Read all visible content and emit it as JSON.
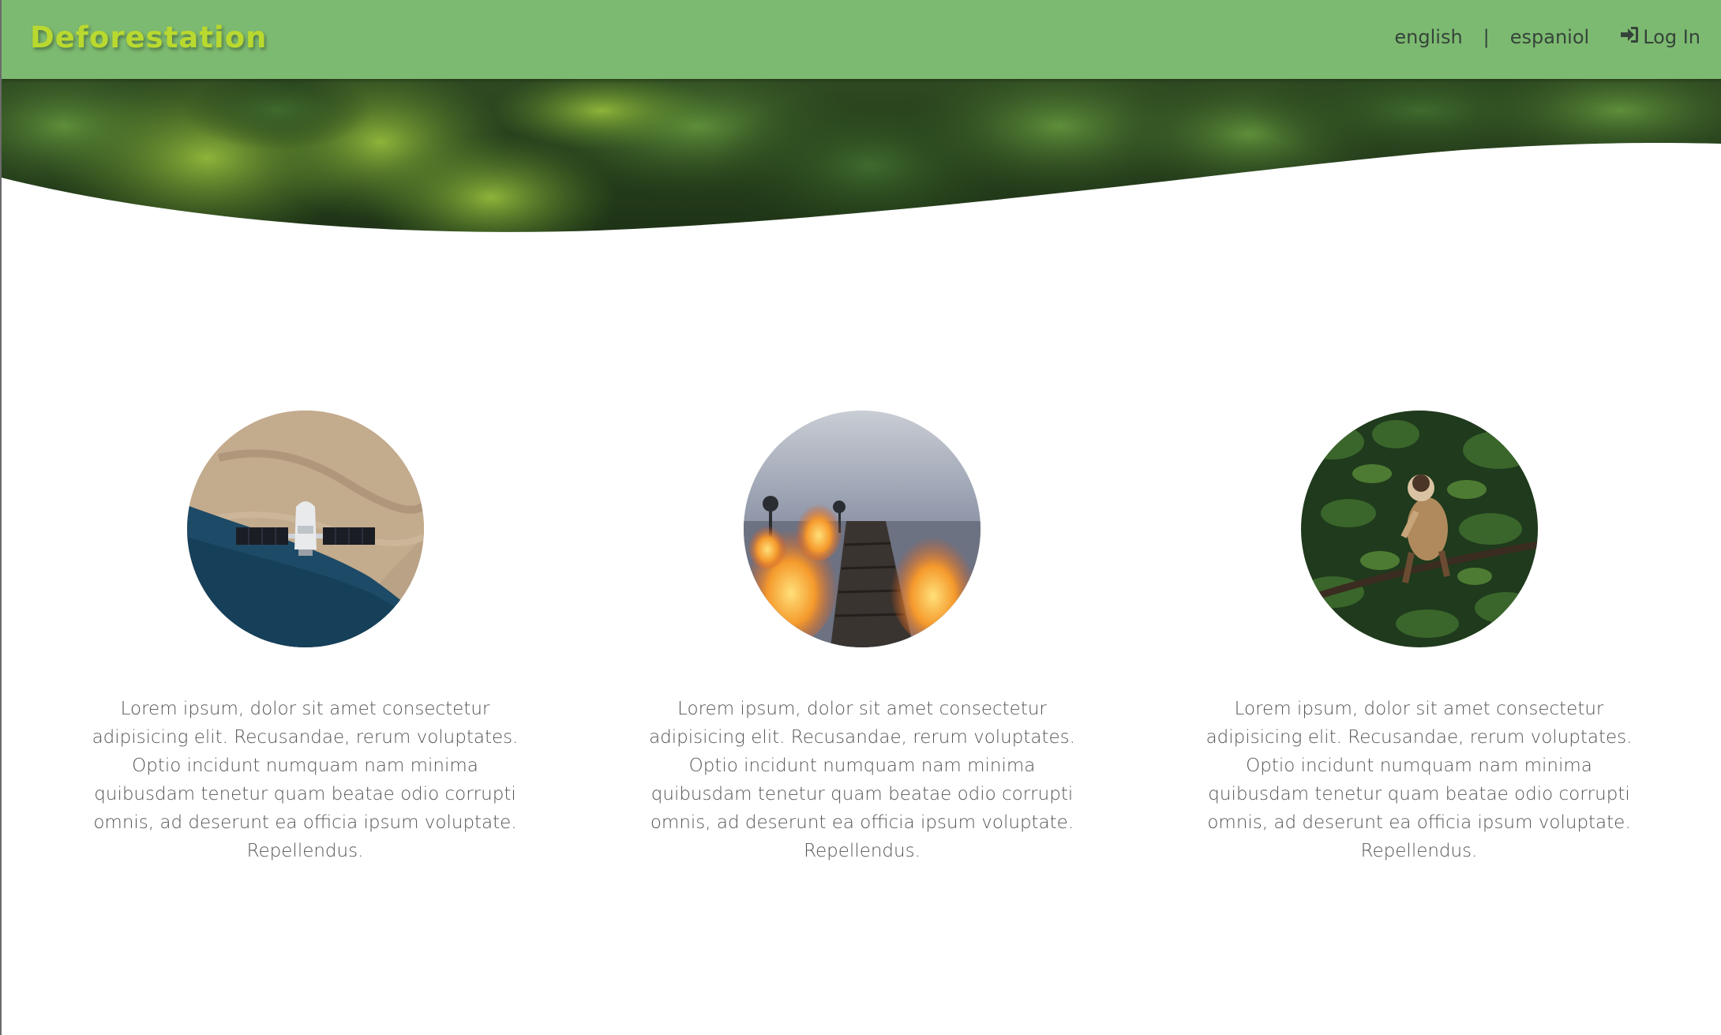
{
  "navbar": {
    "brand": "Deforestation",
    "lang_english": "english",
    "separator": "|",
    "lang_spanish": "espaniol",
    "login_label": "Log In",
    "login_icon": "sign-in-icon",
    "background_color": "#7dba71",
    "brand_color": "#b9d92f"
  },
  "hero": {
    "image": "rainforest-canopy-banner"
  },
  "features": [
    {
      "image": "satellite-over-coastline",
      "text": "Lorem ipsum, dolor sit amet consectetur adipisicing elit. Recusandae, rerum voluptates. Optio incidunt numquam nam minima quibusdam tenetur quam beatae odio corrupti omnis, ad deserunt ea officia ipsum voluptate. Repellendus."
    },
    {
      "image": "burning-log-fire",
      "text": "Lorem ipsum, dolor sit amet consectetur adipisicing elit. Recusandae, rerum voluptates. Optio incidunt numquam nam minima quibusdam tenetur quam beatae odio corrupti omnis, ad deserunt ea officia ipsum voluptate. Repellendus."
    },
    {
      "image": "monkey-on-branch",
      "text": "Lorem ipsum, dolor sit amet consectetur adipisicing elit. Recusandae, rerum voluptates. Optio incidunt numquam nam minima quibusdam tenetur quam beatae odio corrupti omnis, ad deserunt ea officia ipsum voluptate. Repellendus."
    }
  ]
}
